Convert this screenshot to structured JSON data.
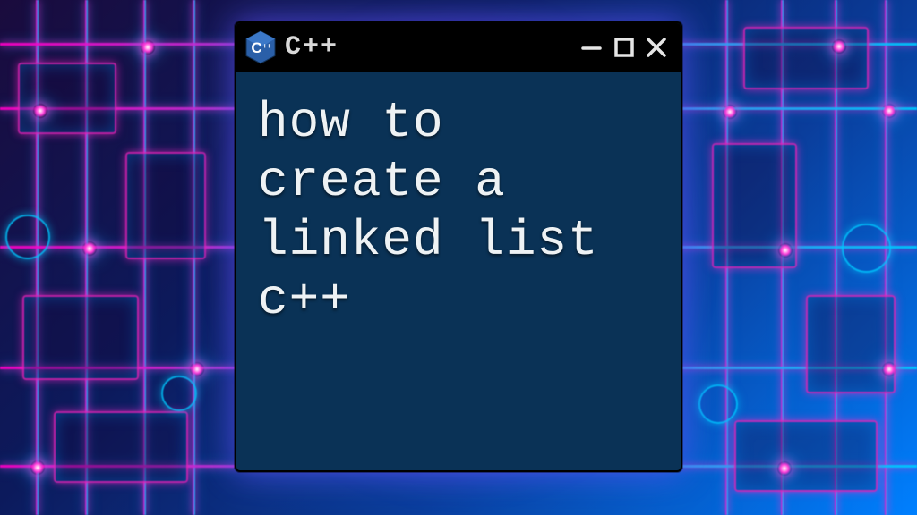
{
  "window": {
    "app_name": "C++",
    "icon_letter": "C",
    "icon_plus": "++"
  },
  "body": {
    "text": "how to\ncreate a\nlinked list\nc++"
  }
}
